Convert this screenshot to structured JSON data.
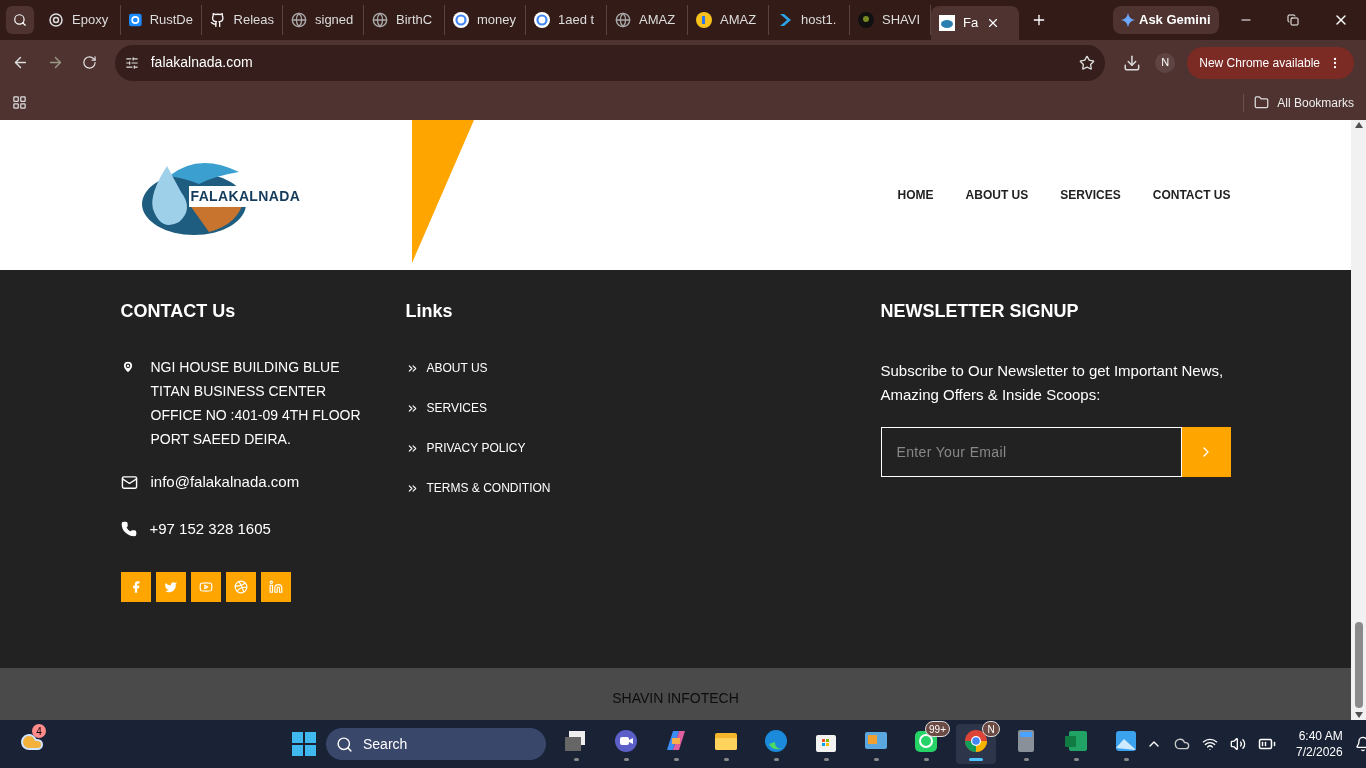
{
  "browser": {
    "tabs": [
      {
        "label": "Epoxy",
        "kind": "spiral",
        "selected": false
      },
      {
        "label": "RustDe",
        "kind": "sync",
        "selected": false
      },
      {
        "label": "Releas",
        "kind": "cat",
        "selected": false
      },
      {
        "label": "signed",
        "kind": "globe",
        "selected": false
      },
      {
        "label": "BirthC",
        "kind": "globe",
        "selected": false
      },
      {
        "label": "money",
        "kind": "google",
        "selected": false
      },
      {
        "label": "1aed t",
        "kind": "google",
        "selected": false
      },
      {
        "label": "AMAZ",
        "kind": "globe",
        "selected": false
      },
      {
        "label": "AMAZ",
        "kind": "yellow",
        "selected": false
      },
      {
        "label": "host1.",
        "kind": "chevron",
        "selected": false
      },
      {
        "label": "SHAVI",
        "kind": "dark",
        "selected": false
      },
      {
        "label": "Fa",
        "kind": "site",
        "selected": true
      }
    ],
    "gemini": "Ask Gemini",
    "url": "falakalnada.com",
    "profile": "N",
    "update": "New Chrome available",
    "bookmarks": "All Bookmarks"
  },
  "site": {
    "logo": "FALAKALNADA",
    "nav": [
      "HOME",
      "ABOUT US",
      "SERVICES",
      "CONTACT US"
    ],
    "contact": {
      "title": "CONTACT Us",
      "address": "NGI HOUSE BUILDING BLUE TITAN BUSINESS CENTER OFFICE NO :401-09 4TH FLOOR PORT SAEED DEIRA.",
      "email": "info@falakalnada.com",
      "phone": "+97 152 328 1605",
      "social": [
        {
          "kind": "facebook"
        },
        {
          "kind": "twitter"
        },
        {
          "kind": "youtube"
        },
        {
          "kind": "dribbble"
        },
        {
          "kind": "linkedin"
        }
      ]
    },
    "links": {
      "title": "Links",
      "items": [
        "ABOUT US",
        "SERVICES",
        "PRIVACY POLICY",
        "TERMS & CONDITION"
      ]
    },
    "newsletter": {
      "title": "NEWSLETTER SIGNUP",
      "text": "Subscribe to Our Newsletter to get Important News, Amazing Offers & Inside Scoops:",
      "placeholder": "Enter Your Email"
    },
    "credit": "SHAVIN INFOTECH"
  },
  "taskbar": {
    "weather_badge": "4",
    "search": "Search",
    "apps": [
      {
        "kind": "taskview",
        "active": false
      },
      {
        "kind": "meet",
        "active": false
      },
      {
        "kind": "copilot",
        "active": false
      },
      {
        "kind": "folder",
        "active": false
      },
      {
        "kind": "edge",
        "active": false
      },
      {
        "kind": "store",
        "active": false
      },
      {
        "kind": "screen",
        "active": false
      },
      {
        "kind": "whatsapp",
        "badge": "99+",
        "active": false
      },
      {
        "kind": "chrome",
        "badge": "N",
        "active": true
      },
      {
        "kind": "calculator",
        "active": false
      },
      {
        "kind": "excel",
        "active": false
      },
      {
        "kind": "photos",
        "active": false
      }
    ],
    "time": "6:40 AM",
    "date": "7/2/2026"
  }
}
